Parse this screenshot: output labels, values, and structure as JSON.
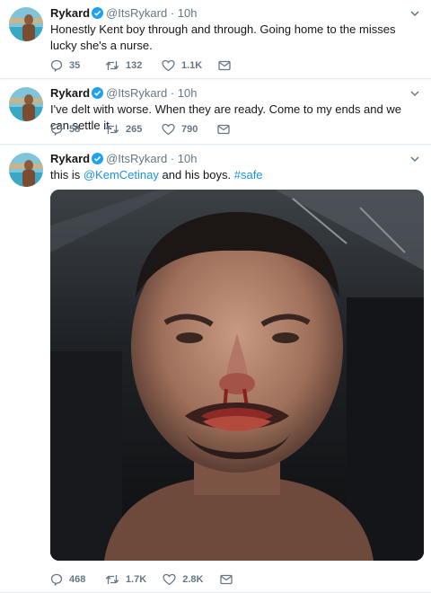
{
  "user": {
    "name": "Rykard",
    "handle": "@ItsRykard",
    "dot": "·"
  },
  "tweets": [
    {
      "time": "10h",
      "text": "Honestly Kent boy through and through. Going home to the misses lucky she's a nurse.",
      "replies": "35",
      "retweets": "132",
      "likes": "1.1K"
    },
    {
      "time": "10h",
      "text": "I've delt with worse. When they are ready. Come to my ends and we can settle it.",
      "replies": "58",
      "retweets": "265",
      "likes": "790"
    },
    {
      "time": "10h",
      "text_prefix": "this is",
      "mention": "@KemCetinay",
      "text_middle": "and his boys.",
      "hashtag": "#safe",
      "replies": "468",
      "retweets": "1.7K",
      "likes": "2.8K",
      "media": "selfie-photo"
    }
  ],
  "icons": [
    "verified-icon",
    "caret-down-icon",
    "reply-icon",
    "retweet-icon",
    "like-icon",
    "message-icon"
  ],
  "colors": {
    "accent": "#1da1f2",
    "link": "#1b95e0",
    "muted": "#657786",
    "text": "#14171a"
  }
}
